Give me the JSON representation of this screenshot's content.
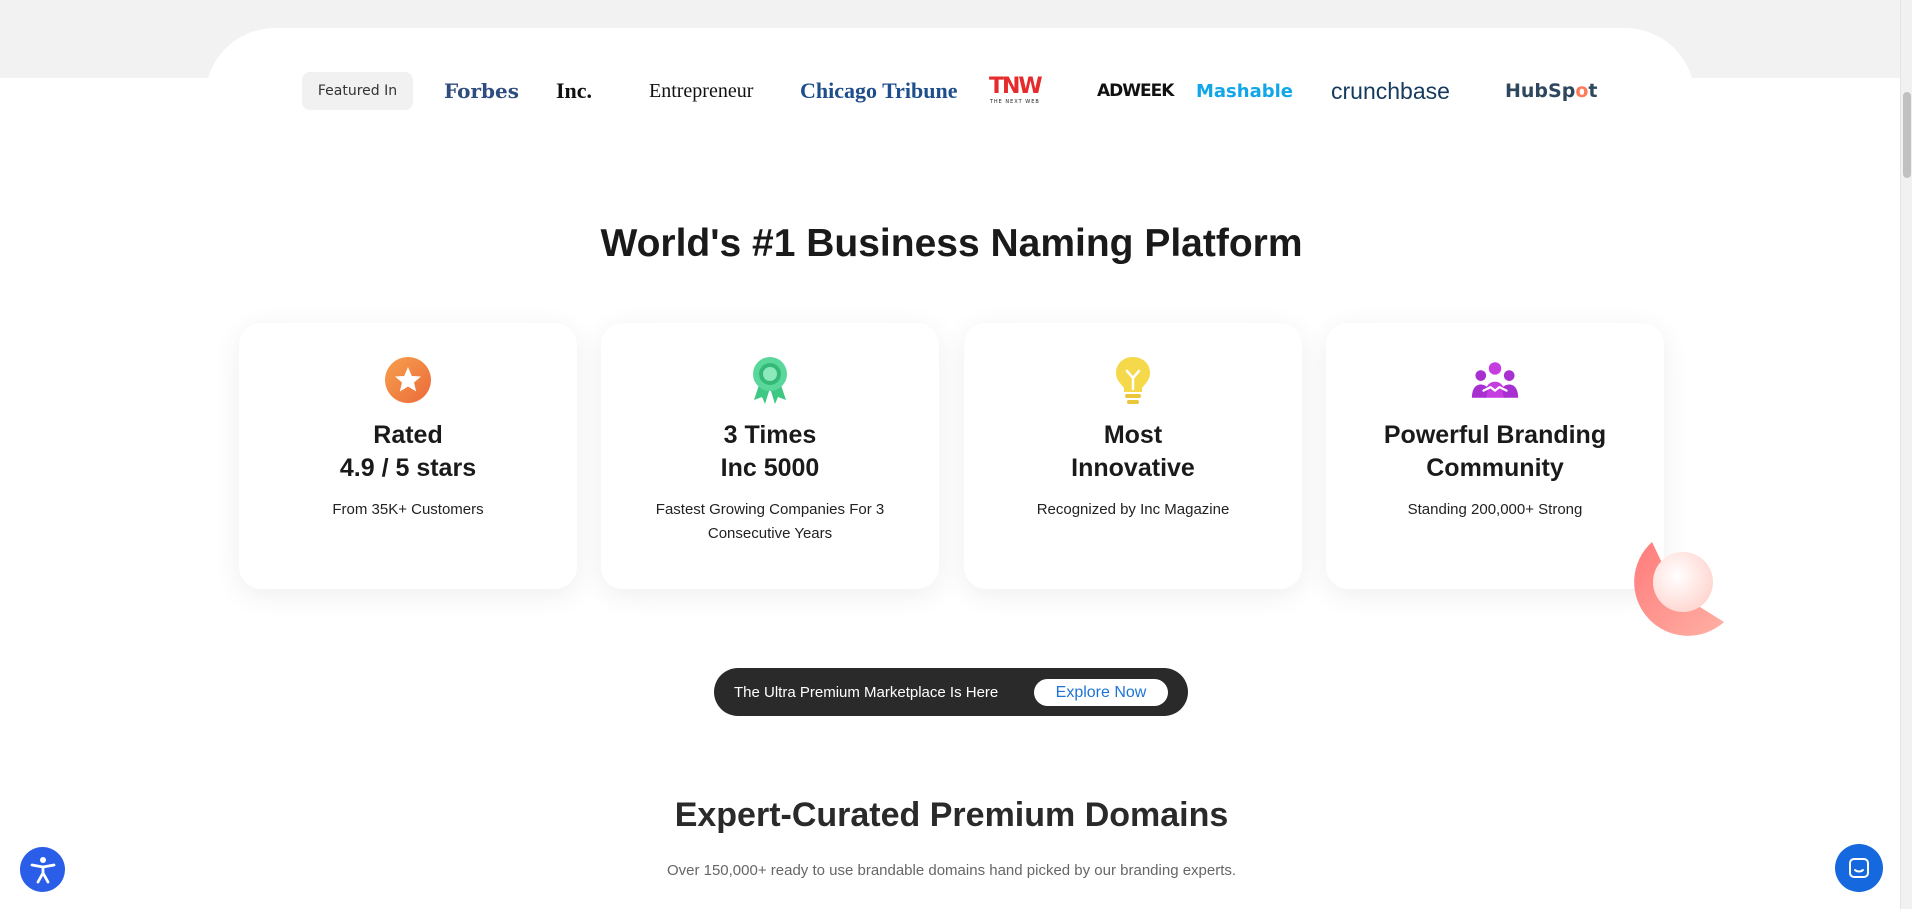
{
  "featured": {
    "label": "Featured In",
    "logos": {
      "forbes": "Forbes",
      "inc": "Inc.",
      "entrepreneur": "Entrepreneur",
      "chicago_tribune": "Chicago Tribune",
      "tnw": "TNW",
      "tnw_sub": "THE NEXT WEB",
      "adweek": "ADWEEK",
      "mashable": "Mashable",
      "crunchbase": "crunchbase",
      "hubspot": "HubSpot"
    }
  },
  "main": {
    "heading": "World's #1 Business Naming Platform",
    "cards": [
      {
        "icon": "star-badge-icon",
        "title_line1": "Rated",
        "title_line2": "4.9 / 5 stars",
        "desc": "From 35K+ Customers"
      },
      {
        "icon": "award-ribbon-icon",
        "title_line1": "3 Times",
        "title_line2": "Inc 5000",
        "desc": "Fastest Growing Companies For 3 Consecutive Years"
      },
      {
        "icon": "lightbulb-icon",
        "title_line1": "Most",
        "title_line2": "Innovative",
        "desc": "Recognized by Inc Magazine"
      },
      {
        "icon": "community-icon",
        "title_line1": "Powerful Branding",
        "title_line2": "Community",
        "desc": "Standing 200,000+ Strong"
      }
    ]
  },
  "banner": {
    "text": "The Ultra Premium Marketplace Is Here",
    "button": "Explore Now"
  },
  "domains": {
    "heading": "Expert-Curated Premium Domains",
    "subheading": "Over 150,000+ ready to use brandable domains hand picked by our branding experts."
  },
  "widgets": {
    "accessibility": "accessibility-icon",
    "chat": "chat-icon"
  },
  "colors": {
    "banner_bg": "#2a2a2a",
    "link_blue": "#1e74d6",
    "chat_blue": "#1668de",
    "a11y_blue": "#2a5ee8"
  }
}
